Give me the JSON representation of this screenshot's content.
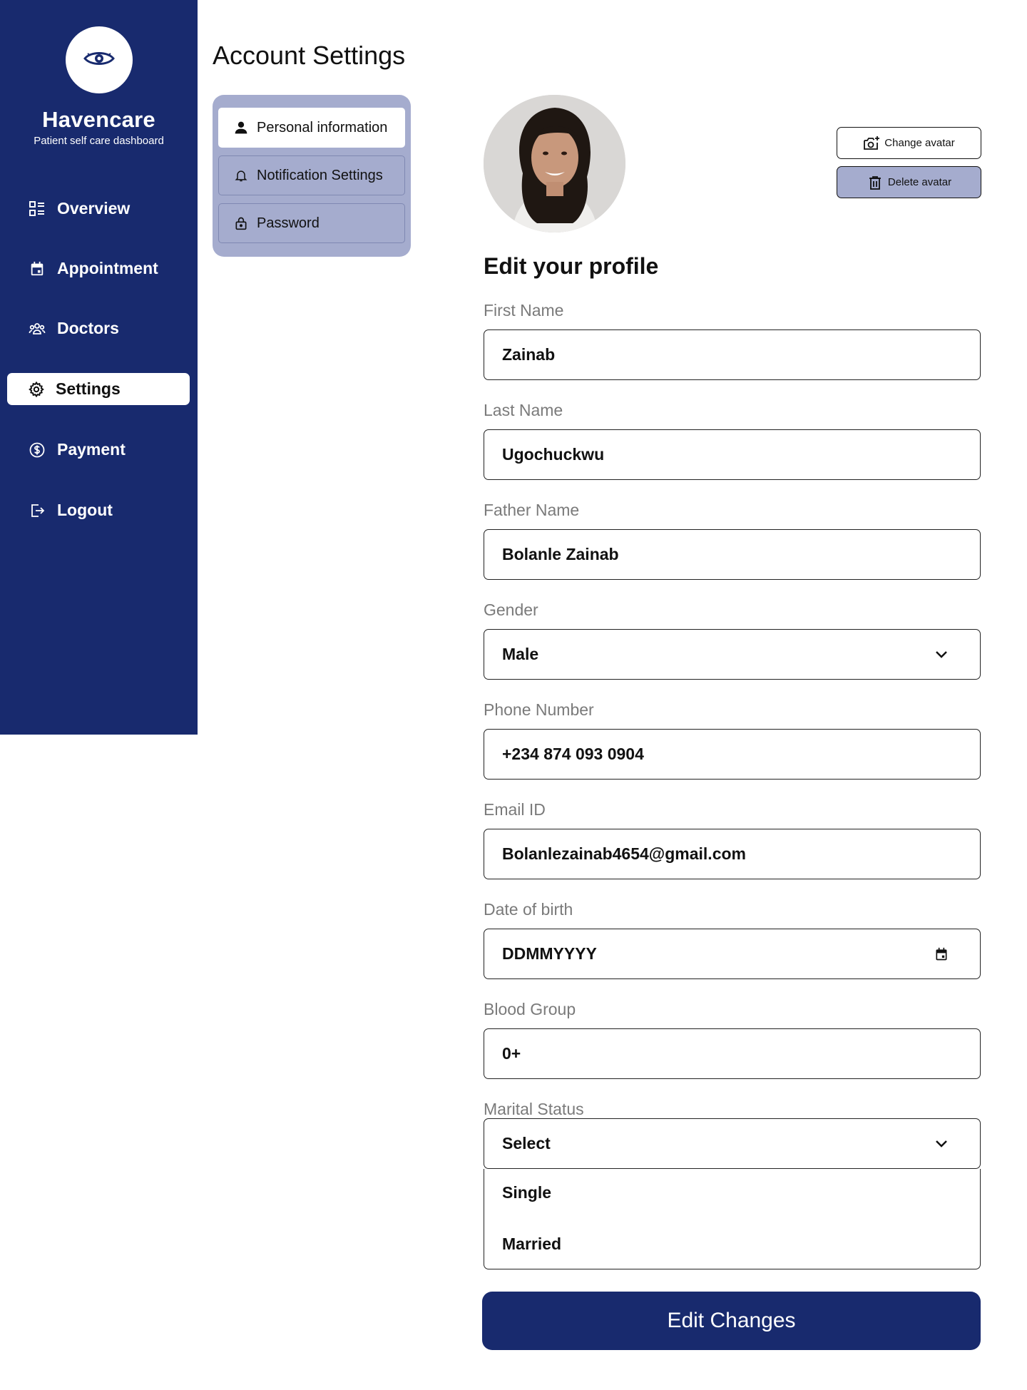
{
  "brand": {
    "title": "Havencare",
    "subtitle": "Patient self care dashboard",
    "logo_icon": "eye-icon"
  },
  "sidebar": {
    "items": [
      {
        "label": "Overview",
        "icon": "grid-list-icon",
        "active": false
      },
      {
        "label": "Appointment",
        "icon": "calendar-icon",
        "active": false
      },
      {
        "label": "Doctors",
        "icon": "group-icon",
        "active": false
      },
      {
        "label": "Settings",
        "icon": "gear-icon",
        "active": true
      },
      {
        "label": "Payment",
        "icon": "dollar-icon",
        "active": false
      },
      {
        "label": "Logout",
        "icon": "logout-icon",
        "active": false
      }
    ]
  },
  "page": {
    "title": "Account Settings"
  },
  "tabs": [
    {
      "label": "Personal information",
      "icon": "person-icon",
      "active": true
    },
    {
      "label": "Notification Settings",
      "icon": "bell-icon",
      "active": false
    },
    {
      "label": "Password",
      "icon": "lock-icon",
      "active": false
    }
  ],
  "avatar": {
    "change_label": "Change avatar",
    "delete_label": "Delete avatar"
  },
  "profile": {
    "title": "Edit your profile",
    "fields": {
      "first_name": {
        "label": "First Name",
        "value": "Zainab"
      },
      "last_name": {
        "label": "Last Name",
        "value": "Ugochuckwu"
      },
      "father_name": {
        "label": "Father Name",
        "value": "Bolanle Zainab"
      },
      "gender": {
        "label": "Gender",
        "value": "Male"
      },
      "phone": {
        "label": "Phone Number",
        "value": "+234 874 093 0904"
      },
      "email": {
        "label": "Email ID",
        "value": "Bolanlezainab4654@gmail.com"
      },
      "dob": {
        "label": "Date of birth",
        "value": "DDMMYYYY"
      },
      "blood_group": {
        "label": "Blood Group",
        "value": "0+"
      },
      "marital_status": {
        "label": "Marital Status",
        "value": "Select",
        "options": [
          "Single",
          "Married"
        ]
      }
    },
    "submit_label": "Edit Changes"
  },
  "colors": {
    "primary": "#182a6e",
    "tab_panel": "#a5acce",
    "label_gray": "#7a7a7a"
  }
}
